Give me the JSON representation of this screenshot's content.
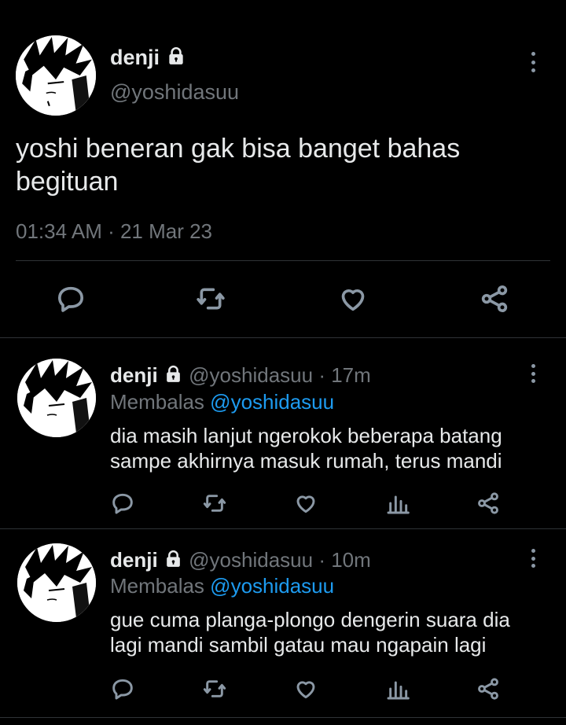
{
  "main_tweet": {
    "display_name": "denji",
    "handle": "@yoshidasuu",
    "text_line1": "yoshi beneran gak bisa banget bahas",
    "text_line2": "begituan",
    "timestamp": "01:34 AM · 21 Mar 23",
    "icons": [
      "reply-icon",
      "retweet-icon",
      "like-icon",
      "share-icon"
    ]
  },
  "replies": [
    {
      "display_name": "denji",
      "handle": "@yoshidasuu",
      "time": "· 17m",
      "replying_prefix": "Membalas",
      "replying_to": "@yoshidasuu",
      "text_line1": "dia masih lanjut ngerokok beberapa batang",
      "text_line2": "sampe akhirnya masuk rumah, terus mandi"
    },
    {
      "display_name": "denji",
      "handle": "@yoshidasuu",
      "time": "· 10m",
      "replying_prefix": "Membalas",
      "replying_to": "@yoshidasuu",
      "text_line1": "gue cuma planga-plongo dengerin suara dia",
      "text_line2": "lagi mandi sambil gatau mau ngapain lagi"
    }
  ],
  "colors": {
    "background": "#000000",
    "text": "#e7e9ea",
    "muted": "#71767b",
    "link": "#1d9bf0",
    "divider": "#2f3336"
  }
}
